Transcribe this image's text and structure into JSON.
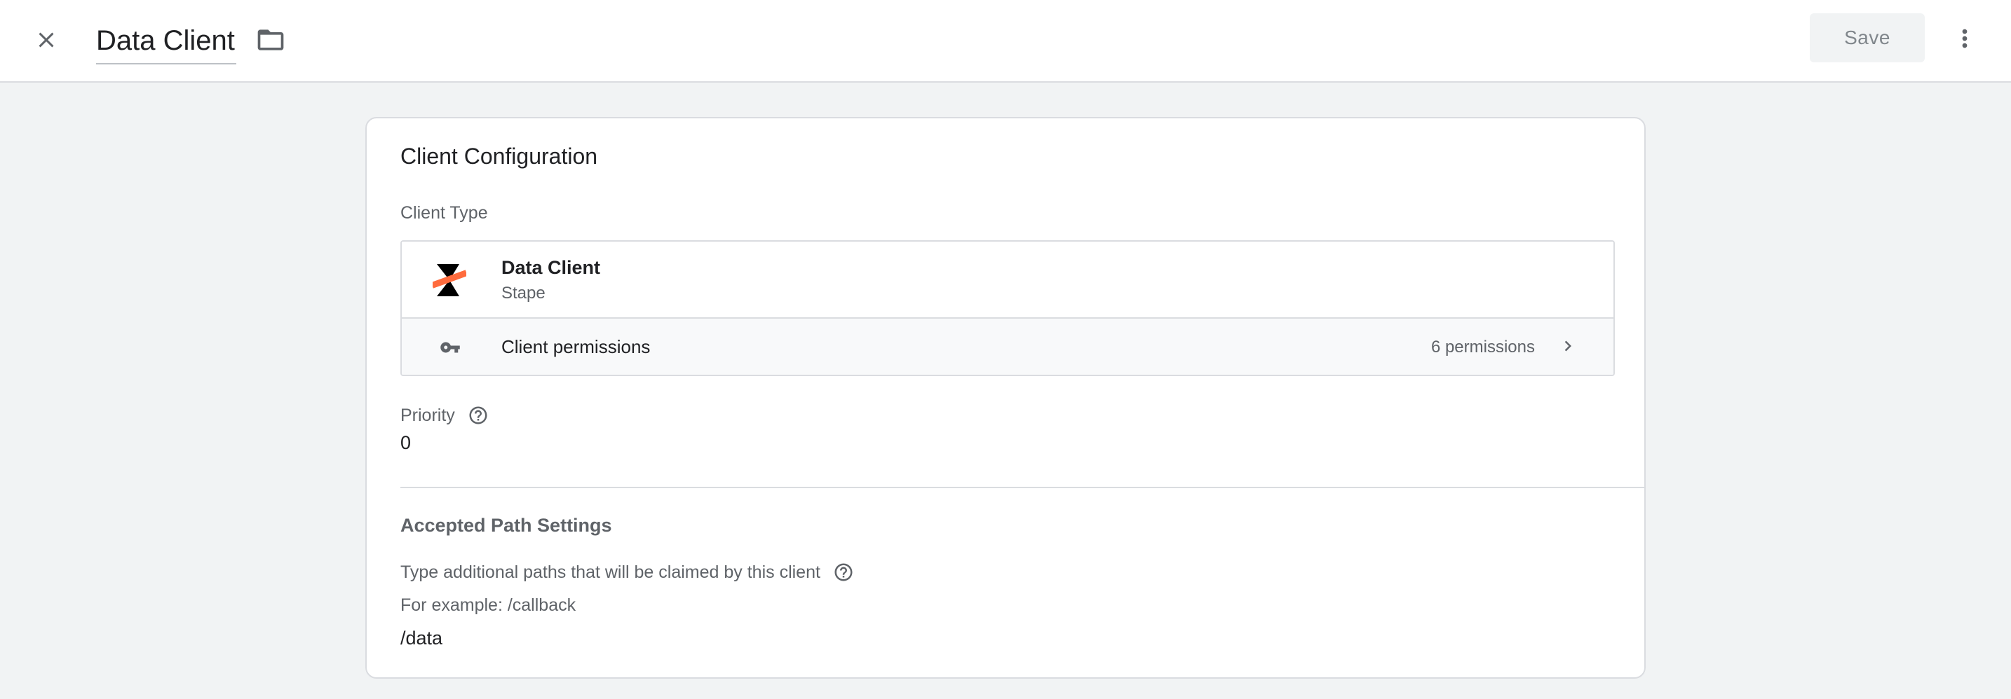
{
  "header": {
    "title": "Data Client",
    "save_label": "Save",
    "icons": {
      "close": "close-icon",
      "folder": "folder-icon",
      "more": "more-vert-icon"
    }
  },
  "card": {
    "title": "Client Configuration",
    "client_type": {
      "label": "Client Type",
      "name": "Data Client",
      "vendor": "Stape",
      "logo": "stape-logo",
      "logo_colors": {
        "mark": "#000000",
        "accent": "#ff6b3d"
      }
    },
    "permissions": {
      "label": "Client permissions",
      "count": "6 permissions",
      "icon": "key-icon"
    },
    "priority": {
      "label": "Priority",
      "value": "0"
    },
    "accepted_paths": {
      "heading": "Accepted Path Settings",
      "description": "Type additional paths that will be claimed by this client",
      "example": "For example: /callback",
      "value": "/data"
    }
  },
  "colors": {
    "background": "#f1f3f4",
    "card": "#ffffff",
    "border": "#dadce0",
    "text_primary": "#202124",
    "text_secondary": "#5f6368",
    "save_disabled_text": "#80868b"
  }
}
